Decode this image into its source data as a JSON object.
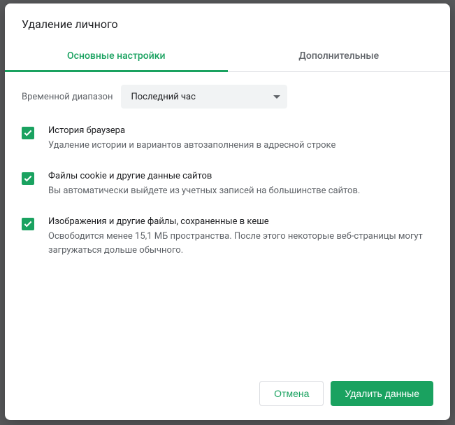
{
  "dialog": {
    "title": "Удаление личного",
    "tabs": {
      "basic": "Основные настройки",
      "advanced": "Дополнительные"
    },
    "range": {
      "label": "Временной диапазон",
      "value": "Последний час"
    },
    "options": [
      {
        "title": "История браузера",
        "desc": "Удаление истории и вариантов автозаполнения в адресной строке"
      },
      {
        "title": "Файлы cookie и другие данные сайтов",
        "desc": "Вы автоматически выйдете из учетных записей на большинстве сайтов."
      },
      {
        "title": "Изображения и другие файлы, сохраненные в кеше",
        "desc": "Освободится менее 15,1 МБ пространства. После этого некоторые веб-страницы могут загружаться дольше обычного."
      }
    ],
    "buttons": {
      "cancel": "Отмена",
      "confirm": "Удалить данные"
    }
  }
}
